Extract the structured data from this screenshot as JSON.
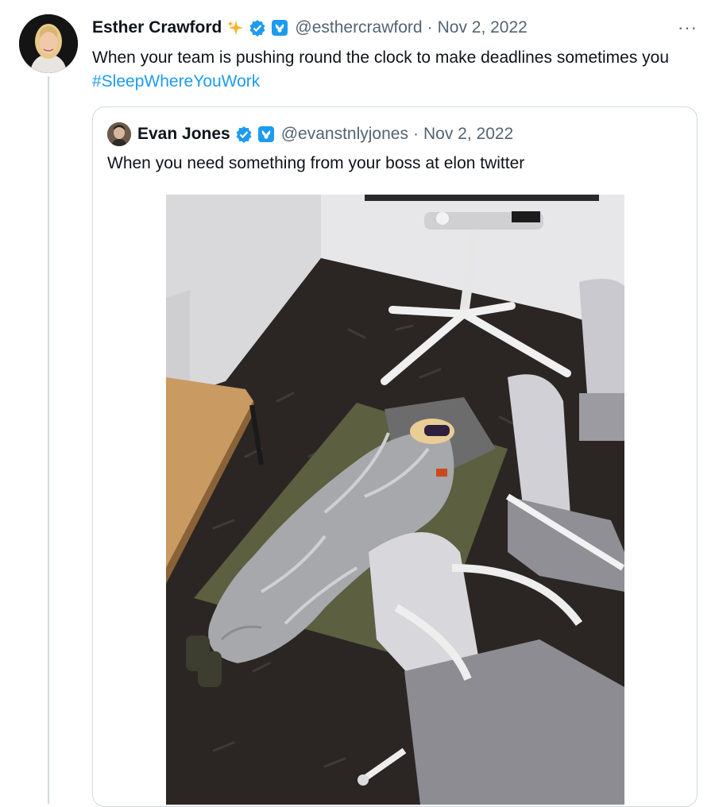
{
  "tweet": {
    "author_name": "Esther Crawford",
    "sparkle_icon": "sparkles-icon",
    "verified_icon": "verified-badge-icon",
    "handle": "@esthercrawford",
    "separator": "·",
    "date": "Nov 2, 2022",
    "more_label": "···",
    "text": "When your team is pushing round the clock to make deadlines sometimes you ",
    "hashtag": "#SleepWhereYouWork"
  },
  "quoted_tweet": {
    "author_name": "Evan Jones",
    "verified_icon": "verified-badge-icon",
    "handle": "@evanstnlyjones",
    "separator": "·",
    "date": "Nov 2, 2022",
    "text": "When you need something from your boss at elon twitter",
    "photo_description": "sleeping-bag-photo"
  },
  "colors": {
    "accent": "#1d9bf0",
    "text_primary": "#0f1419",
    "text_secondary": "#536471",
    "border": "#cfd9de"
  }
}
